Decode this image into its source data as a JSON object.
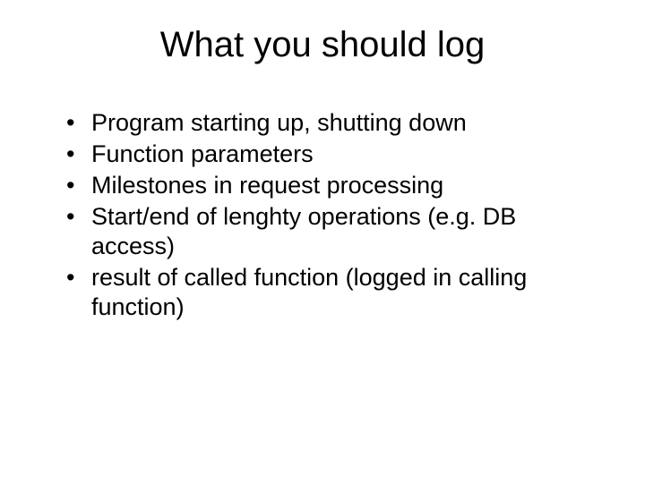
{
  "slide": {
    "title": "What you should log",
    "bullets": [
      "Program starting up, shutting down",
      "Function parameters",
      "Milestones in request processing",
      "Start/end of lenghty operations (e.g. DB access)",
      "result of called function (logged in calling function)"
    ]
  }
}
